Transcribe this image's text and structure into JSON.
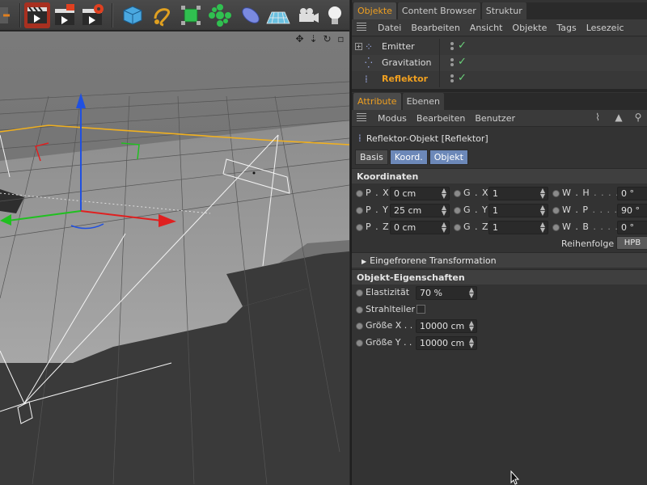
{
  "object_manager": {
    "tabs": [
      "Objekte",
      "Content Browser",
      "Struktur"
    ],
    "menu": [
      "Datei",
      "Bearbeiten",
      "Ansicht",
      "Objekte",
      "Tags",
      "Lesezeic"
    ],
    "objects": [
      {
        "name": "Emitter",
        "icon": "emitter-icon"
      },
      {
        "name": "Gravitation",
        "icon": "gravity-icon"
      },
      {
        "name": "Reflektor",
        "icon": "deflector-icon",
        "selected": true
      }
    ]
  },
  "attribute_manager": {
    "tabs": [
      "Attribute",
      "Ebenen"
    ],
    "menu": [
      "Modus",
      "Bearbeiten",
      "Benutzer"
    ],
    "object_title": "Reflektor-Objekt [Reflektor]",
    "subtabs": [
      "Basis",
      "Koord.",
      "Objekt"
    ],
    "koordinaten": {
      "title": "Koordinaten",
      "rows": [
        {
          "p_label": "P . X",
          "p_value": "0 cm",
          "g_label": "G . X",
          "g_value": "1",
          "w_label": "W . H",
          "w_value": "0 °"
        },
        {
          "p_label": "P . Y",
          "p_value": "25 cm",
          "g_label": "G . Y",
          "g_value": "1",
          "w_label": "W . P",
          "w_value": "90 °"
        },
        {
          "p_label": "P . Z",
          "p_value": "0 cm",
          "g_label": "G . Z",
          "g_value": "1",
          "w_label": "W . B",
          "w_value": "0 °"
        }
      ],
      "order_label": "Reihenfolge",
      "order_value": "HPB"
    },
    "frozen_transform": "Eingefrorene Transformation",
    "objekt_eigenschaften": {
      "title": "Objekt-Eigenschaften",
      "elastizitaet_label": "Elastizität",
      "elastizitaet_value": "70 %",
      "strahlteiler_label": "Strahlteiler",
      "strahlteiler_checked": false,
      "groesse_x_label": "Größe X . .",
      "groesse_x_value": "10000 cm",
      "groesse_y_label": "Größe Y . .",
      "groesse_y_value": "10000 cm"
    }
  },
  "colors": {
    "accent": "#f0a020",
    "active_subtab": "#6c88b8",
    "axis_x": "#e02020",
    "axis_y": "#20c020",
    "axis_z": "#2050e0"
  },
  "toolbar_icons": [
    "undo-icon",
    "render-view-icon",
    "render-picture-viewer-icon",
    "render-settings-icon",
    "cube-icon",
    "spline-icon",
    "nurbs-icon",
    "array-icon",
    "deformer-icon",
    "floor-icon",
    "camera-icon",
    "light-icon"
  ]
}
